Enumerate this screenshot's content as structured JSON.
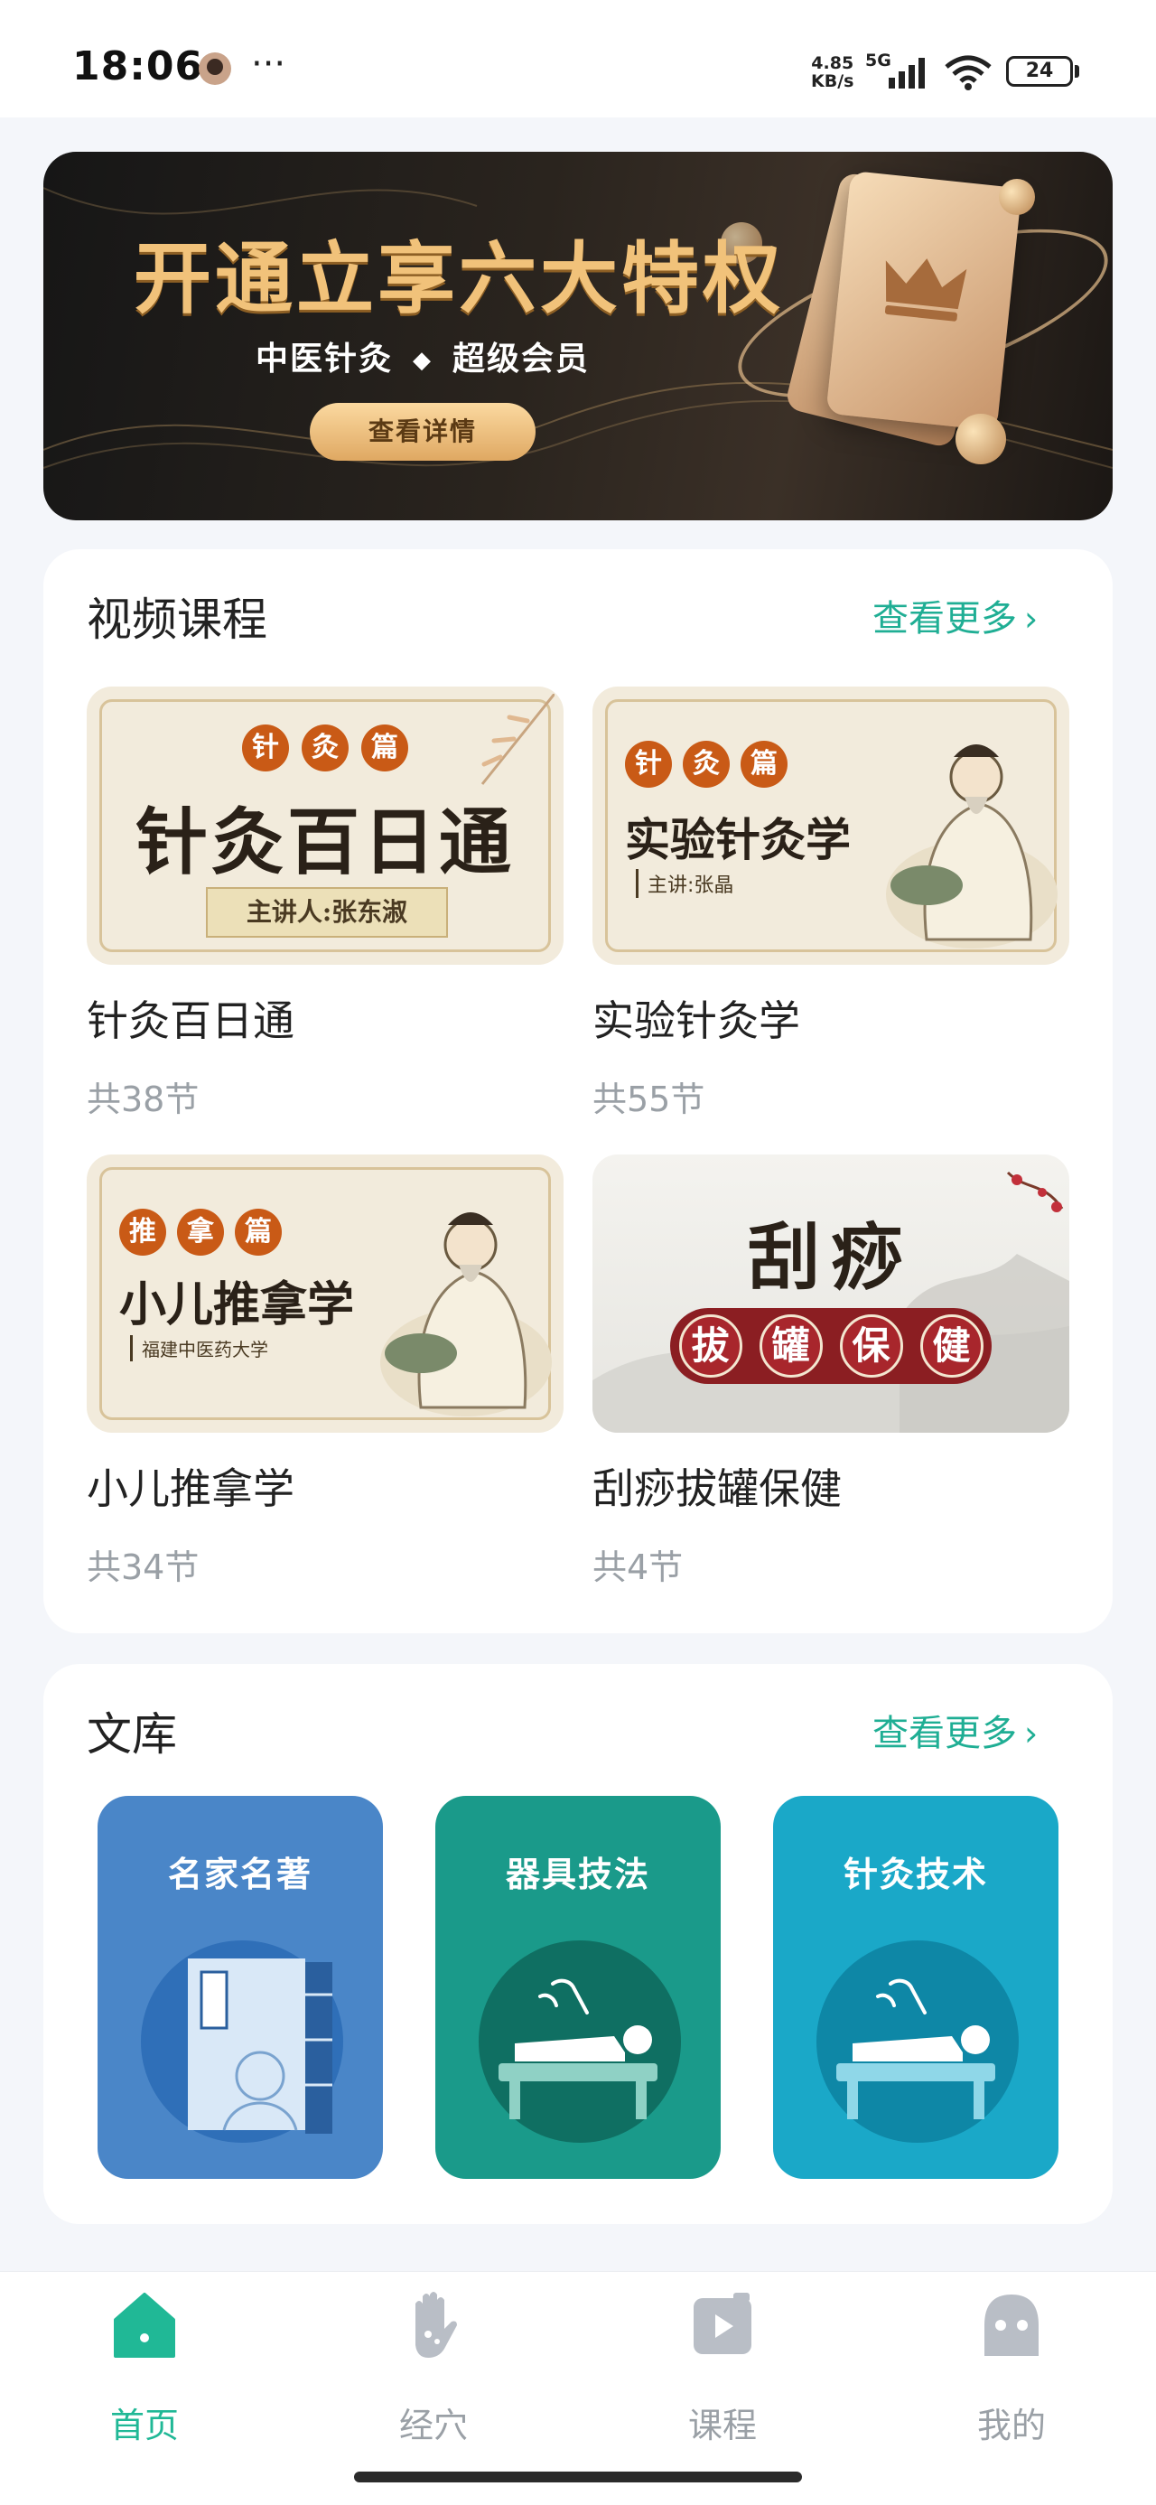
{
  "status_bar": {
    "time": "18:06",
    "dots": "···",
    "net_speed_value": "4.85",
    "net_speed_unit": "KB/s",
    "network": "5G",
    "battery": "24"
  },
  "banner": {
    "title": "开通立享六大特权",
    "subtitle_left": "中医针灸",
    "subtitle_sep": "◆",
    "subtitle_right": "超级会员",
    "button": "查看详情"
  },
  "video_courses": {
    "title": "视频课程",
    "more": "查看更多",
    "items": [
      {
        "tags": [
          "针",
          "灸",
          "篇"
        ],
        "thumb_title": "针灸百日通",
        "thumb_sub": "主讲人:张东淑",
        "name": "针灸百日通",
        "count": "共38节"
      },
      {
        "tags": [
          "针",
          "灸",
          "篇"
        ],
        "thumb_title": "实验针灸学",
        "thumb_sub": "主讲:张晶",
        "name": "实验针灸学",
        "count": "共55节"
      },
      {
        "tags": [
          "推",
          "拿",
          "篇"
        ],
        "thumb_title": "小儿推拿学",
        "thumb_sub": "福建中医药大学",
        "name": "小儿推拿学",
        "count": "共34节"
      },
      {
        "thumb_title": "刮痧",
        "thumb_chars": [
          "拔",
          "罐",
          "保",
          "健"
        ],
        "name": "刮痧拔罐保健",
        "count": "共4节"
      }
    ]
  },
  "library": {
    "title": "文库",
    "more": "查看更多",
    "tiles": [
      {
        "label": "名家名著",
        "icon": "classic-book-icon",
        "color": "#4a86c8"
      },
      {
        "label": "器具技法",
        "icon": "acupuncture-patient-icon",
        "color": "#1a9a8a"
      },
      {
        "label": "针灸技术",
        "icon": "acupuncture-patient-icon",
        "color": "#1aa8c8"
      }
    ]
  },
  "nav": {
    "items": [
      {
        "label": "首页",
        "icon": "home-icon",
        "active": true
      },
      {
        "label": "经穴",
        "icon": "hand-acupoint-icon",
        "active": false
      },
      {
        "label": "课程",
        "icon": "video-icon",
        "active": false
      },
      {
        "label": "我的",
        "icon": "profile-icon",
        "active": false
      }
    ],
    "accent": "#20b896"
  }
}
